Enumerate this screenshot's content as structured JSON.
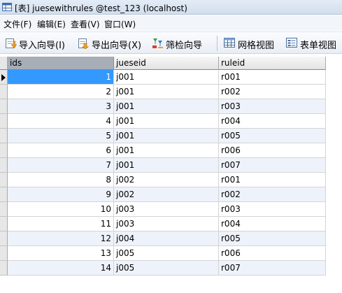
{
  "window": {
    "title": "[表] juesewithrules @test_123 (localhost)"
  },
  "menu": [
    {
      "label": "文件(F)"
    },
    {
      "label": "编辑(E)"
    },
    {
      "label": "查看(V)"
    },
    {
      "label": "窗口(W)"
    }
  ],
  "toolbar": {
    "import_wizard": "导入向导(I)",
    "export_wizard": "导出向导(X)",
    "filter_wizard": "筛检向导",
    "grid_view": "网格视图",
    "form_view": "表单视图"
  },
  "grid": {
    "columns": [
      "ids",
      "jueseid",
      "ruleid"
    ],
    "rows": [
      {
        "ids": "1",
        "jueseid": "j001",
        "ruleid": "r001"
      },
      {
        "ids": "2",
        "jueseid": "j001",
        "ruleid": "r002"
      },
      {
        "ids": "3",
        "jueseid": "j001",
        "ruleid": "r003"
      },
      {
        "ids": "4",
        "jueseid": "j001",
        "ruleid": "r004"
      },
      {
        "ids": "5",
        "jueseid": "j001",
        "ruleid": "r005"
      },
      {
        "ids": "6",
        "jueseid": "j001",
        "ruleid": "r006"
      },
      {
        "ids": "7",
        "jueseid": "j001",
        "ruleid": "r007"
      },
      {
        "ids": "8",
        "jueseid": "j002",
        "ruleid": "r001"
      },
      {
        "ids": "9",
        "jueseid": "j002",
        "ruleid": "r002"
      },
      {
        "ids": "10",
        "jueseid": "j003",
        "ruleid": "r003"
      },
      {
        "ids": "11",
        "jueseid": "j003",
        "ruleid": "r004"
      },
      {
        "ids": "12",
        "jueseid": "j004",
        "ruleid": "r005"
      },
      {
        "ids": "13",
        "jueseid": "j005",
        "ruleid": "r006"
      },
      {
        "ids": "14",
        "jueseid": "j005",
        "ruleid": "r007"
      }
    ]
  },
  "colors": {
    "selection": "#3399ff",
    "sorted_header": "#a7aeb7",
    "alt_row": "#eef2fa"
  },
  "icons": [
    "table-icon",
    "import-icon",
    "export-icon",
    "filter-icon",
    "grid-view-icon",
    "form-view-icon",
    "current-row-caret-icon"
  ]
}
